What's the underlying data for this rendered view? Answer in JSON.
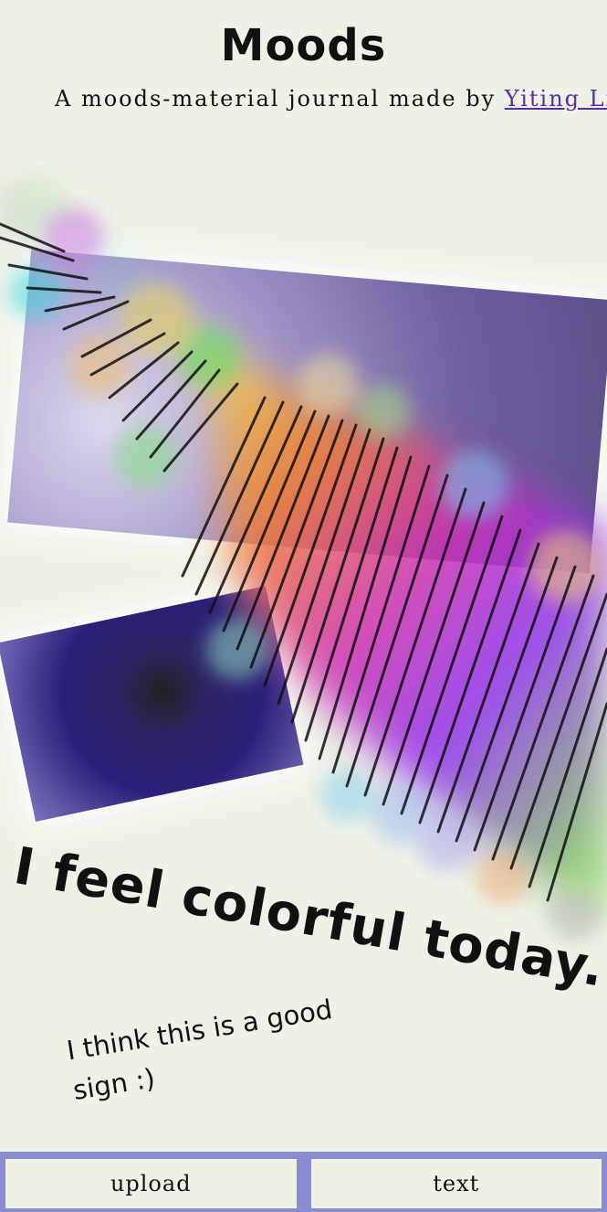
{
  "header": {
    "title": "Moods",
    "subtitle_prefix": "A moods-material journal made by ",
    "author_link": "Yiting Liu"
  },
  "journal": {
    "headline": "I feel colorful today.",
    "note": "I think this is a good sign :)"
  },
  "toolbar": {
    "upload_label": "upload",
    "text_label": "text"
  },
  "colors": {
    "background": "#eef2e6",
    "toolbar": "#8a8cd0",
    "link": "#5a2ea6"
  }
}
